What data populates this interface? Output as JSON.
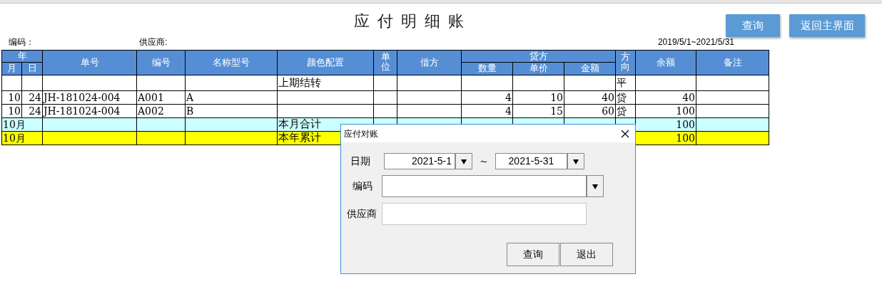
{
  "title": "应付明细账",
  "buttons": [
    {
      "label": "查询"
    },
    {
      "label": "返回主界面"
    }
  ],
  "filters": {
    "code_label": "编码：",
    "supplier_label": "供应商:",
    "date_range": "2019/5/1~2021/5/31"
  },
  "table": {
    "year_header": "年",
    "month_header": "月",
    "day_header": "日",
    "headers": [
      "单号",
      "编号",
      "名称型号",
      "颜色配置",
      "单位",
      "借方"
    ],
    "credit_header": "贷方",
    "credit_subheaders": [
      "数量",
      "单价",
      "金额"
    ],
    "tail_headers": [
      "方向",
      "余额",
      "备注"
    ],
    "rows": [
      {
        "kind": "normal",
        "cells": [
          "",
          "",
          "",
          "",
          "",
          "上期结转",
          "",
          "",
          "",
          "",
          "",
          "平",
          "",
          ""
        ]
      },
      {
        "kind": "normal",
        "cells": [
          "10",
          "24",
          "JH-181024-004",
          "A001",
          "A",
          "",
          "",
          "",
          "4",
          "10",
          "40",
          "贷",
          "40",
          ""
        ]
      },
      {
        "kind": "normal",
        "cells": [
          "10",
          "24",
          "JH-181024-004",
          "A002",
          "B",
          "",
          "",
          "",
          "4",
          "15",
          "60",
          "贷",
          "100",
          ""
        ]
      },
      {
        "kind": "month_total",
        "period": "10月",
        "cells": [
          "",
          "",
          "",
          "本月合计",
          "",
          "",
          "",
          "",
          "",
          "",
          "100",
          ""
        ]
      },
      {
        "kind": "year_total",
        "period": "10月",
        "cells": [
          "",
          "",
          "",
          "本年累计",
          "",
          "",
          "",
          "",
          "",
          "",
          "100",
          ""
        ]
      }
    ]
  },
  "dialog": {
    "title": "应付对账",
    "date_label": "日期",
    "date_from": "2021-5-1",
    "separator": "～",
    "date_to": "2021-5-31",
    "code_label": "编码",
    "supplier_label": "供应商",
    "buttons": [
      "查询",
      "退出"
    ]
  }
}
